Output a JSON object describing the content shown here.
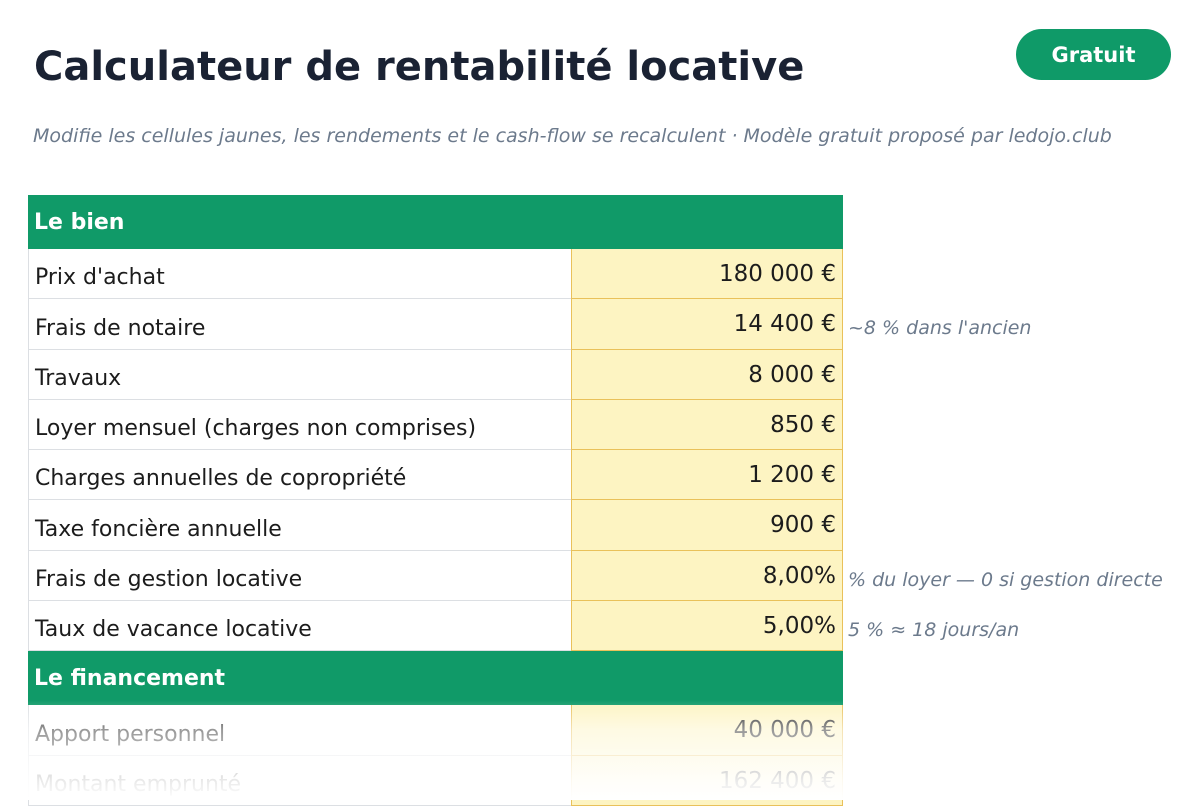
{
  "header": {
    "title": "Calculateur de rentabilité locative",
    "badge": "Gratuit",
    "subtitle": "Modifie les cellules jaunes, les rendements et le cash-flow se recalculent · Modèle gratuit proposé par ledojo.club"
  },
  "colors": {
    "accent_green": "#109a68",
    "input_yellow": "#fdf4c2",
    "input_border": "#e9c15a",
    "note_gray": "#6c7a8c"
  },
  "sections": [
    {
      "title": "Le bien",
      "rows": [
        {
          "label": "Prix d'achat",
          "value": "180 000 €",
          "note": ""
        },
        {
          "label": "Frais de notaire",
          "value": "14 400 €",
          "note": "~8 % dans l'ancien"
        },
        {
          "label": "Travaux",
          "value": "8 000 €",
          "note": ""
        },
        {
          "label": "Loyer mensuel (charges non comprises)",
          "value": "850 €",
          "note": ""
        },
        {
          "label": "Charges annuelles de copropriété",
          "value": "1 200 €",
          "note": ""
        },
        {
          "label": "Taxe foncière annuelle",
          "value": "900 €",
          "note": ""
        },
        {
          "label": "Frais de gestion locative",
          "value": "8,00%",
          "note": "% du loyer — 0 si gestion directe"
        },
        {
          "label": "Taux de vacance locative",
          "value": "5,00%",
          "note": "5 % ≈ 18 jours/an"
        }
      ]
    },
    {
      "title": "Le financement",
      "rows": [
        {
          "label": "Apport personnel",
          "value": "40 000 €",
          "note": ""
        },
        {
          "label": "Montant emprunté",
          "value": "162 400 €",
          "note": ""
        }
      ]
    }
  ]
}
